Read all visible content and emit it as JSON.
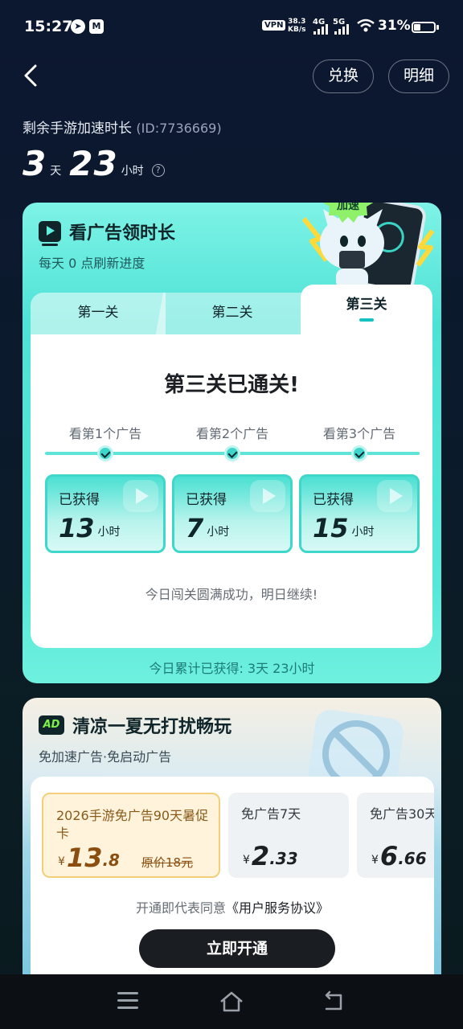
{
  "status_bar": {
    "time": "15:27",
    "vpn": "VPN",
    "speed_value": "38.3",
    "speed_unit": "KB/s",
    "net1": "4G",
    "net2": "5G",
    "battery": "31%"
  },
  "header": {
    "exchange_label": "兑换",
    "detail_label": "明细"
  },
  "remaining": {
    "label": "剩余手游加速时长",
    "id_text": "(ID:7736669)",
    "days": "3",
    "days_unit": "天",
    "hours": "23",
    "hours_unit": "小时",
    "help": "?"
  },
  "ad_card": {
    "title": "看广告领时长",
    "subtitle": "每天 0 点刷新进度",
    "badge": "免费加速",
    "tabs": [
      "第一关",
      "第二关",
      "第三关"
    ],
    "active_tab": 2,
    "passed_title": "第三关已通关!",
    "steps": [
      {
        "label": "看第1个广告",
        "got": "已获得",
        "hours": "13",
        "unit": "小时"
      },
      {
        "label": "看第2个广告",
        "got": "已获得",
        "hours": "7",
        "unit": "小时"
      },
      {
        "label": "看第3个广告",
        "got": "已获得",
        "hours": "15",
        "unit": "小时"
      }
    ],
    "done_message": "今日闯关圆满成功，明日继续!",
    "total": "今日累计已获得: 3天 23小时"
  },
  "summer_card": {
    "title": "清凉一夏无打扰畅玩",
    "subtitle": "免加速广告·免启动广告",
    "ad_icon": "AD",
    "plans": [
      {
        "name": "2026手游免广告90天暑促卡",
        "currency": "¥",
        "price_int": "13",
        "price_dec": ".8",
        "original": "原价18元"
      },
      {
        "name": "免广告7天",
        "currency": "¥",
        "price_int": "2",
        "price_dec": ".33"
      },
      {
        "name": "免广告30天",
        "currency": "¥",
        "price_int": "6",
        "price_dec": ".66"
      }
    ],
    "agree_prefix": "开通即代表同意",
    "agree_link": "《用户服务协议》",
    "open_button": "立即开通"
  },
  "colors": {
    "accent_teal": "#4ee2d6",
    "dark": "#10252a"
  },
  "icons": [
    "back-icon",
    "help-icon",
    "tv-play-icon",
    "check-icon",
    "ad-icon",
    "menu-icon",
    "home-icon",
    "return-icon"
  ]
}
